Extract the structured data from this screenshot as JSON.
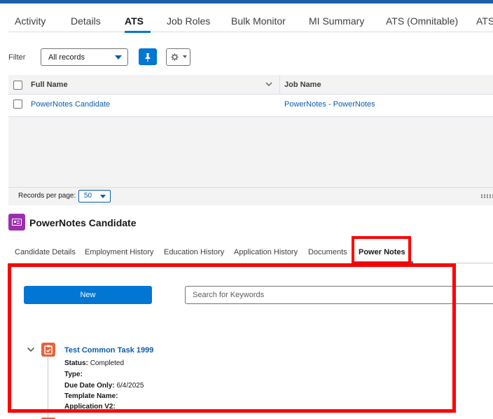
{
  "top_tabs": {
    "items": [
      {
        "label": "Activity"
      },
      {
        "label": "Details"
      },
      {
        "label": "ATS"
      },
      {
        "label": "Job Roles"
      },
      {
        "label": "Bulk Monitor"
      },
      {
        "label": "MI Summary"
      },
      {
        "label": "ATS (Omnitable)"
      },
      {
        "label": "ATS"
      }
    ],
    "active_index": 2
  },
  "filter": {
    "label": "Filter",
    "selected_value": "All records"
  },
  "table": {
    "columns": [
      "Full Name",
      "Job Name"
    ],
    "rows": [
      {
        "full_name": "PowerNotes Candidate",
        "job_name": "PowerNotes - PowerNotes"
      }
    ],
    "footer": {
      "records_per_page_label": "Records per page:",
      "records_per_page_value": "50"
    }
  },
  "record": {
    "title": "PowerNotes Candidate"
  },
  "sub_tabs": {
    "items": [
      {
        "label": "Candidate Details"
      },
      {
        "label": "Employment History"
      },
      {
        "label": "Education History"
      },
      {
        "label": "Application History"
      },
      {
        "label": "Documents"
      },
      {
        "label": "Power Notes"
      }
    ],
    "active_index": 5
  },
  "power_notes": {
    "new_button_label": "New",
    "search_placeholder": "Search for Keywords",
    "task": {
      "title": "Test Common Task 1999",
      "fields": [
        {
          "label": "Status:",
          "value": "Completed"
        },
        {
          "label": "Type:",
          "value": ""
        },
        {
          "label": "Due Date Only:",
          "value": "6/4/2025"
        },
        {
          "label": "Template Name:",
          "value": ""
        },
        {
          "label": "Application V2:",
          "value": ""
        }
      ]
    }
  },
  "colors": {
    "brand_blue": "#0176d3",
    "link_blue": "#0b5cab",
    "record_icon": "#9b2fae",
    "task_icon": "#e8623b",
    "highlight": "#ff0000"
  },
  "icons": {
    "pin": "pin-icon",
    "settings": "gear-icon",
    "record": "contact-card-icon",
    "task": "task-clipboard-icon",
    "expand": "chevron-down-icon"
  }
}
